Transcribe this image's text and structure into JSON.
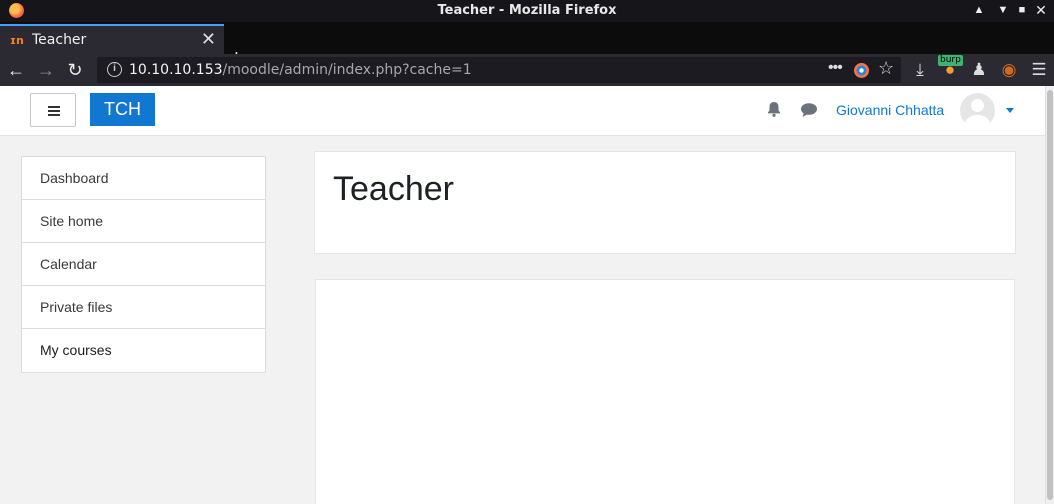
{
  "window": {
    "title": "Teacher - Mozilla Firefox",
    "controls": [
      "minimize",
      "maximize",
      "close"
    ]
  },
  "tab": {
    "label": "Teacher",
    "favicon_text": "m"
  },
  "urlbar": {
    "host": "10.10.10.153",
    "path": "/moodle/admin/index.php?cache=1",
    "more_glyph": "•••"
  },
  "extensions": {
    "burp_label": "burp"
  },
  "site": {
    "brand": "TCH",
    "user_name": "Giovanni Chhatta",
    "nav_items": [
      {
        "label": "Dashboard"
      },
      {
        "label": "Site home"
      },
      {
        "label": "Calendar"
      },
      {
        "label": "Private files"
      },
      {
        "label": "My courses"
      }
    ],
    "page_heading": "Teacher"
  },
  "icons": {
    "accent": "#1177d1",
    "firefox_bar": "#2b2a33"
  }
}
